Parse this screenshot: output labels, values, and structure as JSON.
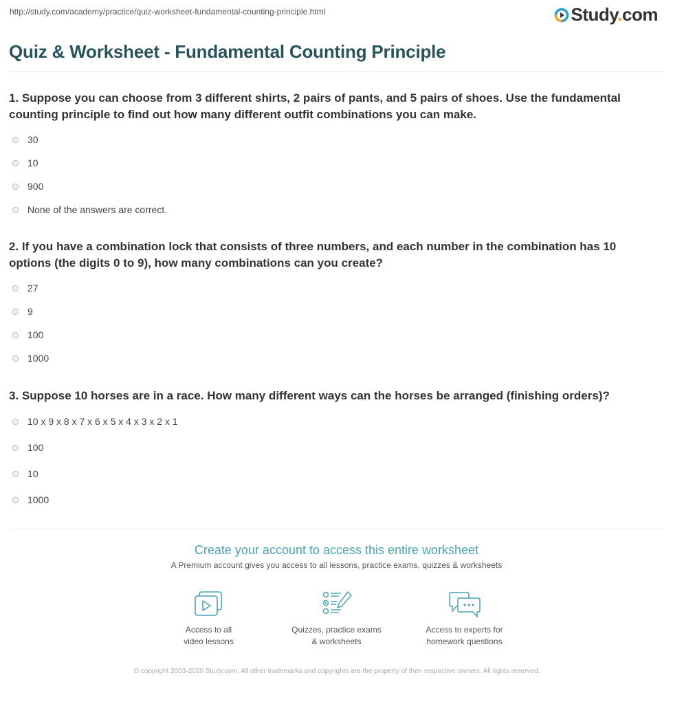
{
  "url": "http://study.com/academy/practice/quiz-worksheet-fundamental-counting-principle.html",
  "logo": {
    "text": "Study",
    "dot": ".",
    "suffix": "com",
    "icon": "play-circle-icon",
    "accent": "#f5a623",
    "brand": "#2a9fd6"
  },
  "title": "Quiz & Worksheet - Fundamental Counting Principle",
  "questions": [
    {
      "text": "1. Suppose you can choose from 3 different shirts, 2 pairs of pants, and 5 pairs of shoes. Use the fundamental counting principle to find out how many different outfit combinations you can make.",
      "options": [
        "30",
        "10",
        "900",
        "None of the answers are correct."
      ]
    },
    {
      "text": "2. If you have a combination lock that consists of three numbers, and each number in the combination has 10 options (the digits 0 to 9), how many combinations can you create?",
      "options": [
        "27",
        "9",
        "100",
        "1000"
      ]
    },
    {
      "text": "3. Suppose 10 horses are in a race. How many different ways can the horses be arranged (finishing orders)?",
      "options": [
        "10 x 9 x 8 x 7 x 6 x 5 x 4 x 3 x 2 x 1",
        "100",
        "10",
        "1000"
      ]
    }
  ],
  "cta": {
    "title": "Create your account to access this entire worksheet",
    "subtitle": "A Premium account gives you access to all lessons, practice exams, quizzes & worksheets",
    "features": [
      {
        "icon": "video-lessons-icon",
        "label": "Access to all\nvideo lessons"
      },
      {
        "icon": "quiz-checklist-icon",
        "label": "Quizzes, practice exams\n& worksheets"
      },
      {
        "icon": "chat-bubbles-icon",
        "label": "Access to experts for\nhomework questions"
      }
    ],
    "icon_color": "#4aa3b7"
  },
  "copyright": "© copyright 2003-2020 Study.com. All other trademarks and copyrights are the property of their respective owners. All rights reserved."
}
